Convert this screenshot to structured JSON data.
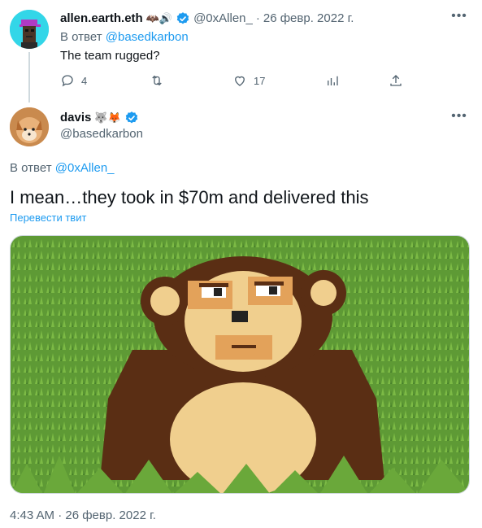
{
  "reply_tweet": {
    "display_name": "allen.earth.eth",
    "name_emojis": "🦇🔊",
    "handle": "@0xAllen_",
    "separator": "·",
    "date": "26 февр. 2022 г.",
    "reply_prefix": "В ответ",
    "reply_to": "@basedkarbon",
    "text": "The team rugged?",
    "reply_count": "4",
    "like_count": "17",
    "avatar_icon": "punk-avatar"
  },
  "main_tweet": {
    "display_name": "davis",
    "name_emojis": "🐺🦊",
    "handle": "@basedkarbon",
    "reply_prefix": "В ответ",
    "reply_to": "@0xAllen_",
    "text": "I mean…they took in $70m and delivered this",
    "translate_label": "Перевести твит",
    "timestamp": "4:43 AM · 26 февр. 2022 г.",
    "avatar_icon": "fox-avatar",
    "media_description_icon": "pixel-monkey-image"
  },
  "colors": {
    "accent": "#1d9bf0",
    "muted": "#536471",
    "text": "#0f1419",
    "border": "#cfd9de",
    "grass": "#5e9a35",
    "monkey_brown": "#5a2e14",
    "monkey_tan": "#f0cf8e",
    "monkey_orange": "#e3a25a"
  }
}
